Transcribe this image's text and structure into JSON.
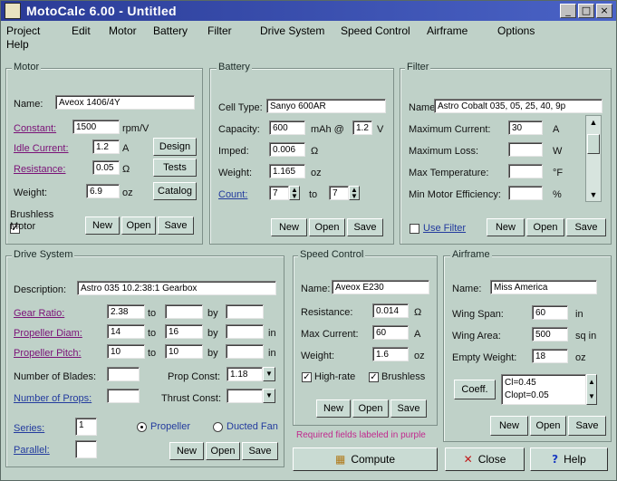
{
  "window": {
    "title": "MotoCalc 6.00 - Untitled",
    "minimize": "_",
    "maximize": "□",
    "close": "×"
  },
  "menu": [
    "Project",
    "Edit",
    "Motor",
    "Battery",
    "Filter",
    "Drive System",
    "Speed Control",
    "Airframe",
    "Options",
    "Help"
  ],
  "motor": {
    "group": "Motor",
    "name_label": "Name:",
    "name": "Aveox 1406/4Y",
    "constant_label": "Constant:",
    "constant": "1500",
    "constant_unit": "rpm/V",
    "idle_label": "Idle Current:",
    "idle": "1.2",
    "idle_unit": "A",
    "resistance_label": "Resistance:",
    "resistance": "0.05",
    "resistance_unit": "Ω",
    "weight_label": "Weight:",
    "weight": "6.9",
    "weight_unit": "oz",
    "brushless_label": "Brushless Motor",
    "buttons": {
      "design": "Design",
      "tests": "Tests",
      "catalog": "Catalog",
      "new": "New",
      "open": "Open",
      "save": "Save"
    }
  },
  "battery": {
    "group": "Battery",
    "celltype_label": "Cell Type:",
    "celltype": "Sanyo 600AR",
    "capacity_label": "Capacity:",
    "capacity": "600",
    "capacity_unit": "mAh @",
    "capacity_v": "1.2",
    "capacity_v_unit": "V",
    "imped_label": "Imped:",
    "imped": "0.006",
    "imped_unit": "Ω",
    "weight_label": "Weight:",
    "weight": "1.165",
    "weight_unit": "oz",
    "count_label": "Count:",
    "count_from": "7",
    "count_to_label": "to",
    "count_to": "7",
    "buttons": {
      "new": "New",
      "open": "Open",
      "save": "Save"
    }
  },
  "filter": {
    "group": "Filter",
    "name_label": "Name:",
    "name": "Astro Cobalt 035, 05, 25, 40, 9p",
    "max_current_label": "Maximum Current:",
    "max_current": "30",
    "max_current_unit": "A",
    "max_loss_label": "Maximum Loss:",
    "max_loss": "",
    "max_loss_unit": "W",
    "max_temp_label": "Max Temperature:",
    "max_temp": "",
    "max_temp_unit": "°F",
    "min_eff_label": "Min Motor Efficiency:",
    "min_eff": "",
    "min_eff_unit": "%",
    "use_filter": "Use Filter",
    "buttons": {
      "new": "New",
      "open": "Open",
      "save": "Save"
    }
  },
  "drive": {
    "group": "Drive System",
    "desc_label": "Description:",
    "desc": "Astro 035 10.2:38:1 Gearbox",
    "gear_label": "Gear Ratio:",
    "gear_from": "2.38",
    "gear_to": "",
    "gear_by": "",
    "diam_label": "Propeller Diam:",
    "diam_from": "14",
    "diam_to": "16",
    "diam_by": "",
    "diam_unit": "in",
    "pitch_label": "Propeller Pitch:",
    "pitch_from": "10",
    "pitch_to": "10",
    "pitch_by": "",
    "pitch_unit": "in",
    "to": "to",
    "by": "by",
    "blades_label": "Number of Blades:",
    "blades": "",
    "props_label": "Number of Props:",
    "props": "",
    "propconst_label": "Prop Const:",
    "propconst": "1.18",
    "thrustconst_label": "Thrust Const:",
    "thrustconst": "",
    "series_label": "Series:",
    "series": "1",
    "parallel_label": "Parallel:",
    "parallel": "",
    "propeller": "Propeller",
    "ducted": "Ducted Fan",
    "buttons": {
      "new": "New",
      "open": "Open",
      "save": "Save"
    }
  },
  "speed": {
    "group": "Speed Control",
    "name_label": "Name:",
    "name": "Aveox E230",
    "resistance_label": "Resistance:",
    "resistance": "0.014",
    "resistance_unit": "Ω",
    "max_label": "Max Current:",
    "max": "60",
    "max_unit": "A",
    "weight_label": "Weight:",
    "weight": "1.6",
    "weight_unit": "oz",
    "highrate": "High-rate",
    "brushless": "Brushless",
    "buttons": {
      "new": "New",
      "open": "Open",
      "save": "Save"
    }
  },
  "airframe": {
    "group": "Airframe",
    "name_label": "Name:",
    "name": "Miss America",
    "span_label": "Wing Span:",
    "span": "60",
    "span_unit": "in",
    "area_label": "Wing Area:",
    "area": "500",
    "area_unit": "sq in",
    "weight_label": "Empty Weight:",
    "weight": "18",
    "weight_unit": "oz",
    "coeff_button": "Coeff.",
    "coeff_lines": [
      "Cl=0.45",
      "Clopt=0.05"
    ],
    "buttons": {
      "new": "New",
      "open": "Open",
      "save": "Save"
    }
  },
  "footer": {
    "note": "Required fields labeled in purple",
    "compute": "Compute",
    "close": "Close",
    "help": "Help"
  },
  "colors": {
    "titlebar": "#2a3b96",
    "background": "#bfd1c8",
    "required": "#7a1177",
    "link": "#233b9e"
  }
}
